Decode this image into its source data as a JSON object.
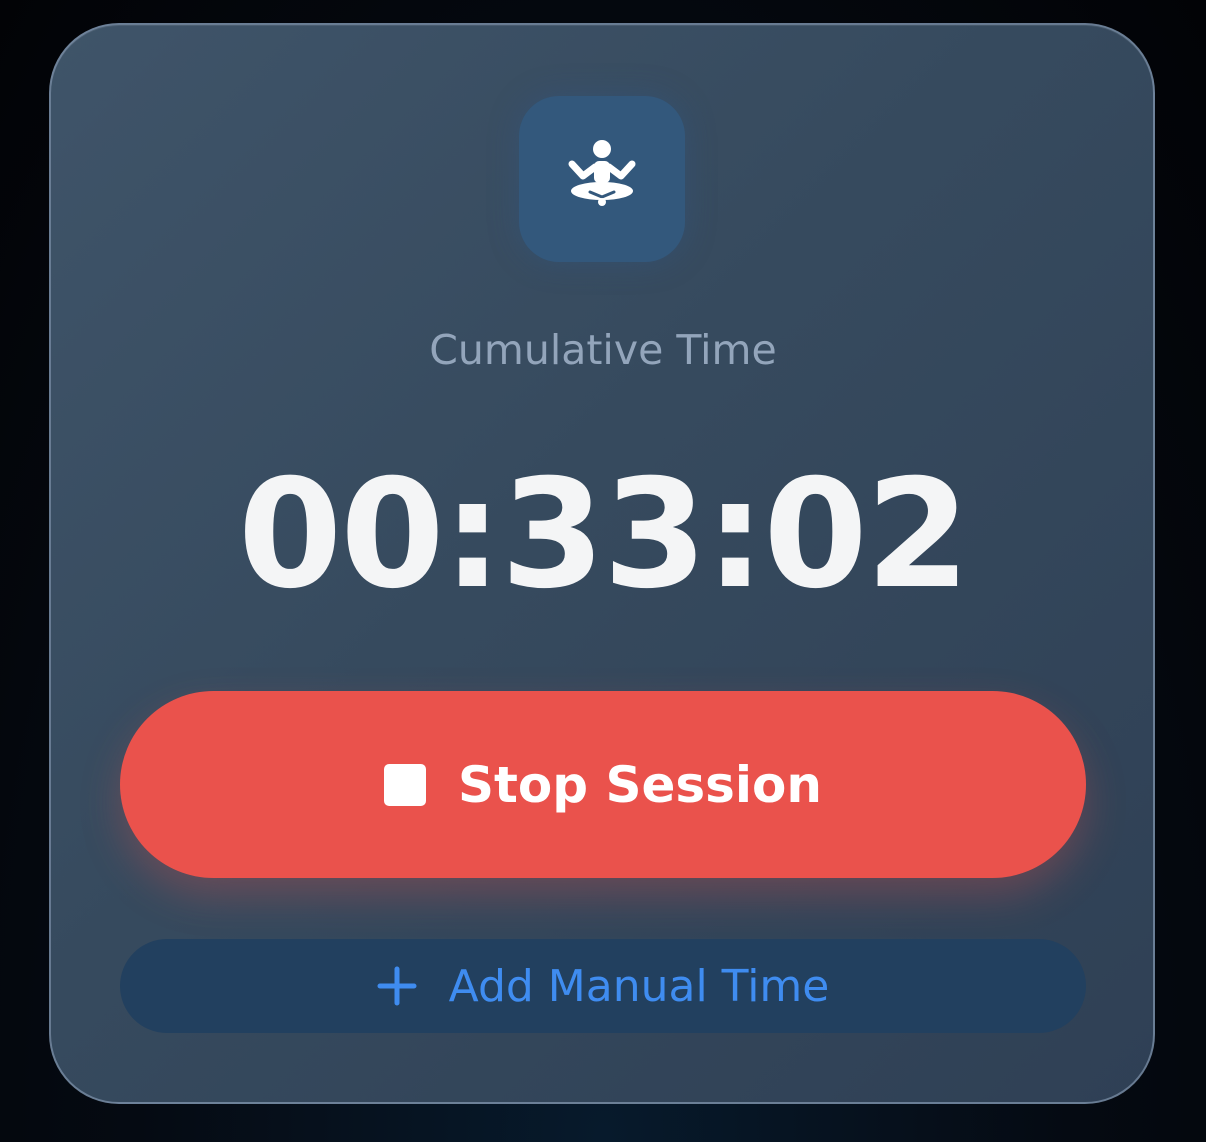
{
  "card": {
    "icon": "meditation-person-icon",
    "label": "Cumulative Time",
    "timer": "00:33:02"
  },
  "stop_button": {
    "icon": "stop-square-icon",
    "label": "Stop Session",
    "color": "#ea524c"
  },
  "manual_button": {
    "icon": "plus-icon",
    "label": "Add Manual Time",
    "color": "#3f8cf0"
  }
}
